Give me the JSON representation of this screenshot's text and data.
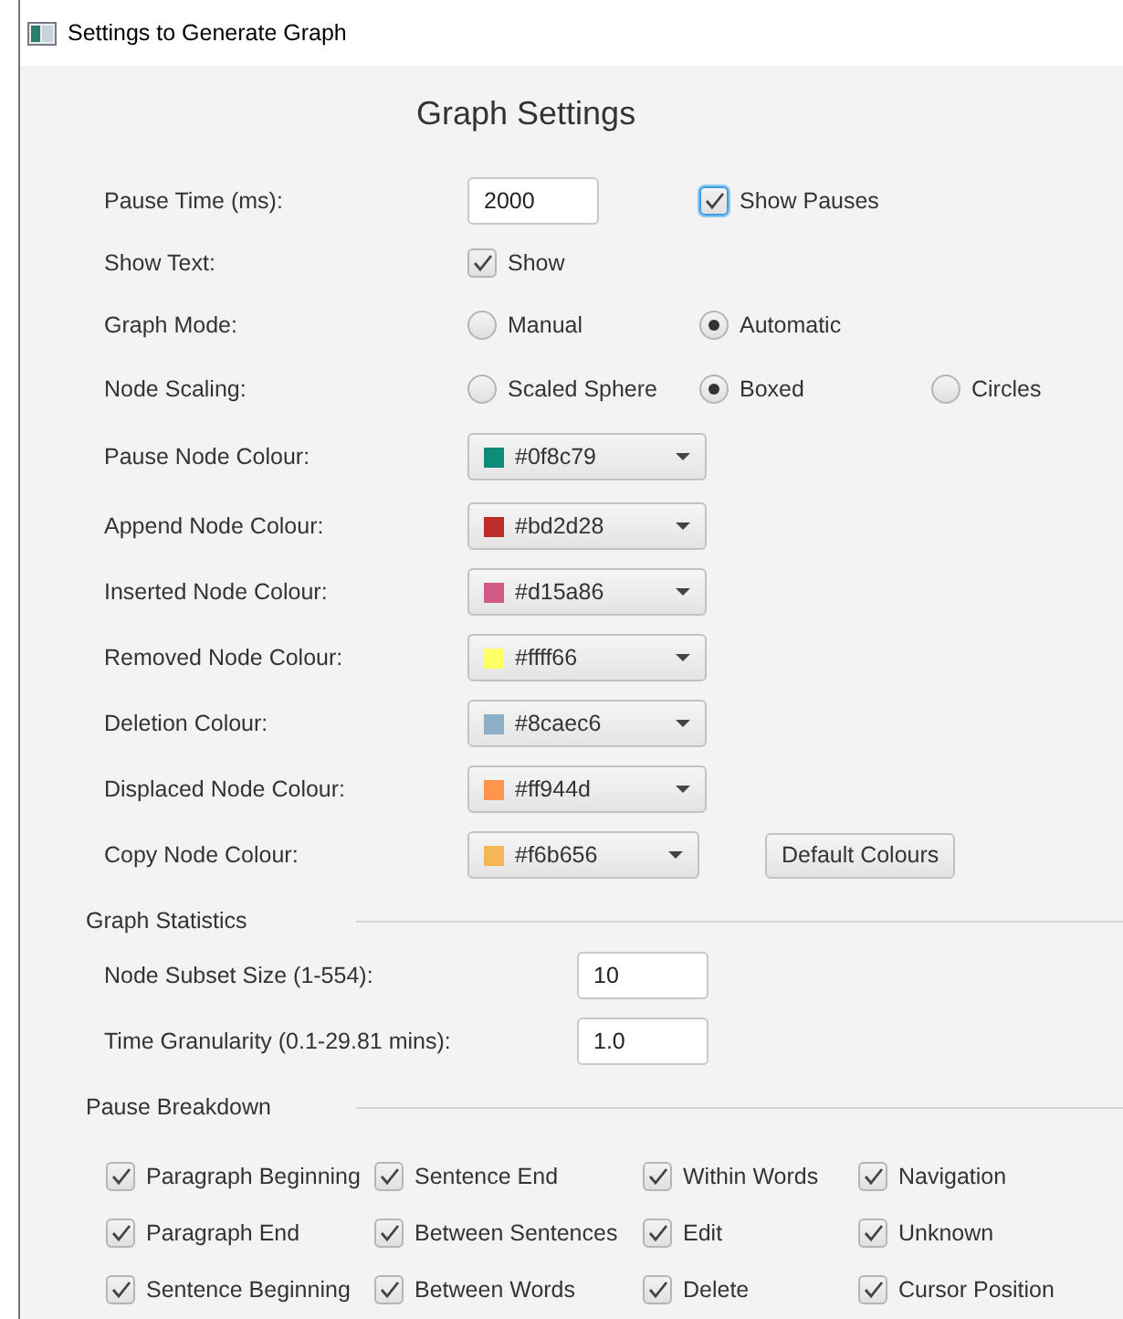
{
  "window": {
    "title": "Settings to Generate Graph"
  },
  "heading": "Graph Settings",
  "pause_time": {
    "label": "Pause Time (ms):",
    "value": "2000"
  },
  "show_pauses": {
    "label": "Show Pauses",
    "checked": true,
    "focused": true
  },
  "show_text": {
    "label": "Show Text:",
    "checkbox": {
      "label": "Show",
      "checked": true
    }
  },
  "radio_groups": [
    {
      "label": "Graph Mode:",
      "options": [
        {
          "label": "Manual",
          "selected": false
        },
        {
          "label": "Automatic",
          "selected": true
        }
      ]
    },
    {
      "label": "Node Scaling:",
      "options": [
        {
          "label": "Scaled Sphere",
          "selected": false
        },
        {
          "label": "Boxed",
          "selected": true
        },
        {
          "label": "Circles",
          "selected": false
        }
      ]
    }
  ],
  "colours": [
    {
      "label": "Pause Node Colour:",
      "value": "#0f8c79",
      "color": "#0f8c79"
    },
    {
      "label": "Append Node Colour:",
      "value": "#bd2d28",
      "color": "#bd2d28"
    },
    {
      "label": "Inserted Node Colour:",
      "value": "#d15a86",
      "color": "#d15a86"
    },
    {
      "label": "Removed Node Colour:",
      "value": "#ffff66",
      "color": "#ffff66"
    },
    {
      "label": "Deletion Colour:",
      "value": "#8caec6",
      "color": "#8caec6"
    },
    {
      "label": "Displaced Node Colour:",
      "value": "#ff944d",
      "color": "#ff944d"
    },
    {
      "label": "Copy Node Colour:",
      "value": "#f6b656",
      "color": "#f6b656"
    }
  ],
  "default_button": "Default Colours",
  "statistics": {
    "title": "Graph Statistics",
    "fields": [
      {
        "label": "Node Subset Size (1-554):",
        "value": "10"
      },
      {
        "label": "Time Granularity (0.1-29.81 mins):",
        "value": "1.0"
      }
    ]
  },
  "breakdown": {
    "title": "Pause Breakdown",
    "items": [
      {
        "label": "Paragraph Beginning",
        "checked": true
      },
      {
        "label": "Sentence End",
        "checked": true
      },
      {
        "label": "Within Words",
        "checked": true
      },
      {
        "label": "Navigation",
        "checked": true
      },
      {
        "label": "Paragraph End",
        "checked": true
      },
      {
        "label": "Between Sentences",
        "checked": true
      },
      {
        "label": "Edit",
        "checked": true
      },
      {
        "label": "Unknown",
        "checked": true
      },
      {
        "label": "Sentence Beginning",
        "checked": true
      },
      {
        "label": "Between Words",
        "checked": true
      },
      {
        "label": "Delete",
        "checked": true
      },
      {
        "label": "Cursor Position",
        "checked": true
      }
    ]
  }
}
